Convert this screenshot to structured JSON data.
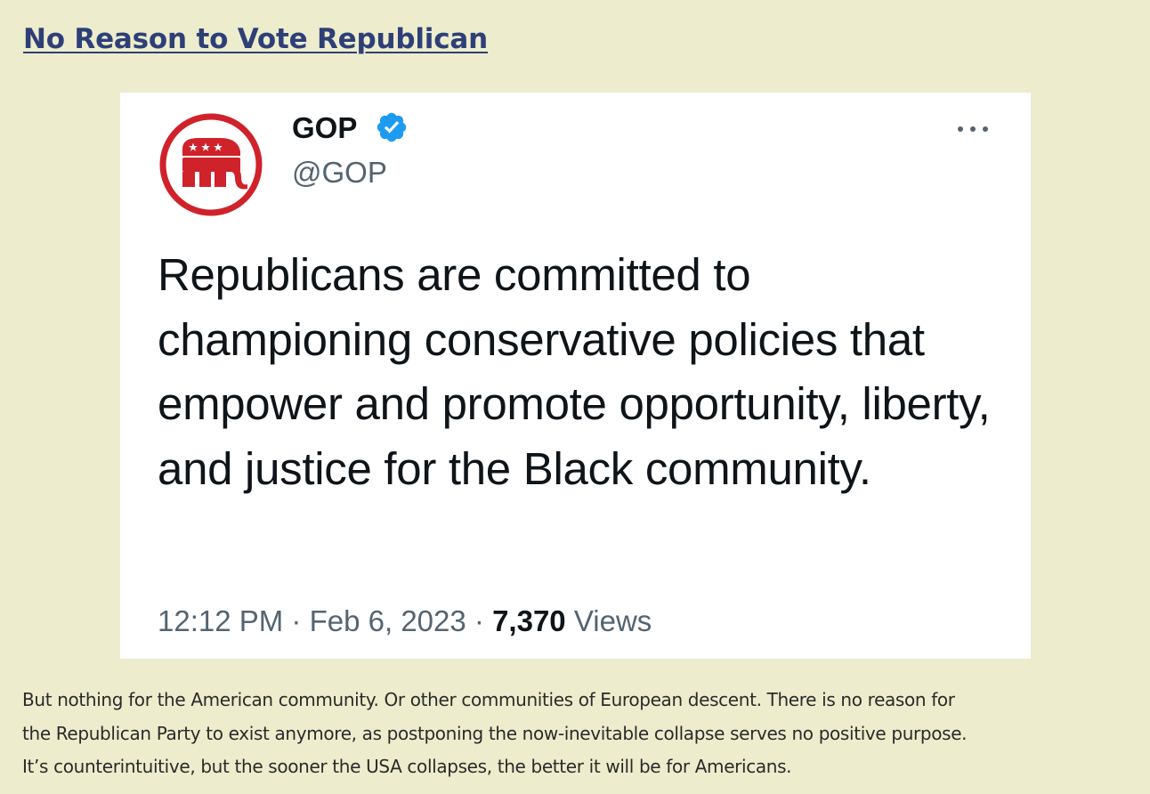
{
  "post": {
    "title": "No Reason to Vote Republican",
    "body_lines": [
      "But nothing for the American community. Or other communities of European descent. There is no reason for",
      "the Republican Party to exist anymore, as postponing the now-inevitable collapse serves no positive purpose.",
      "It’s counterintuitive, but the sooner the USA collapses, the better it will be for Americans."
    ]
  },
  "tweet": {
    "author_name": "GOP",
    "author_handle": "@GOP",
    "avatar_icon": "gop-elephant-logo",
    "verified_icon": "verified-badge-icon",
    "more_icon": "more-options-icon",
    "text": "Republicans are committed to championing conservative policies that empower and promote opportunity, liberty, and justice for the Black community.",
    "time": "12:12 PM",
    "separator": "·",
    "date": "Feb 6, 2023",
    "views_count": "7,370",
    "views_label": "Views"
  },
  "colors": {
    "page_background": "#ededcd",
    "title_link": "#2e3f78",
    "gop_red": "#d0222a",
    "verified_blue": "#1d9bf0"
  }
}
